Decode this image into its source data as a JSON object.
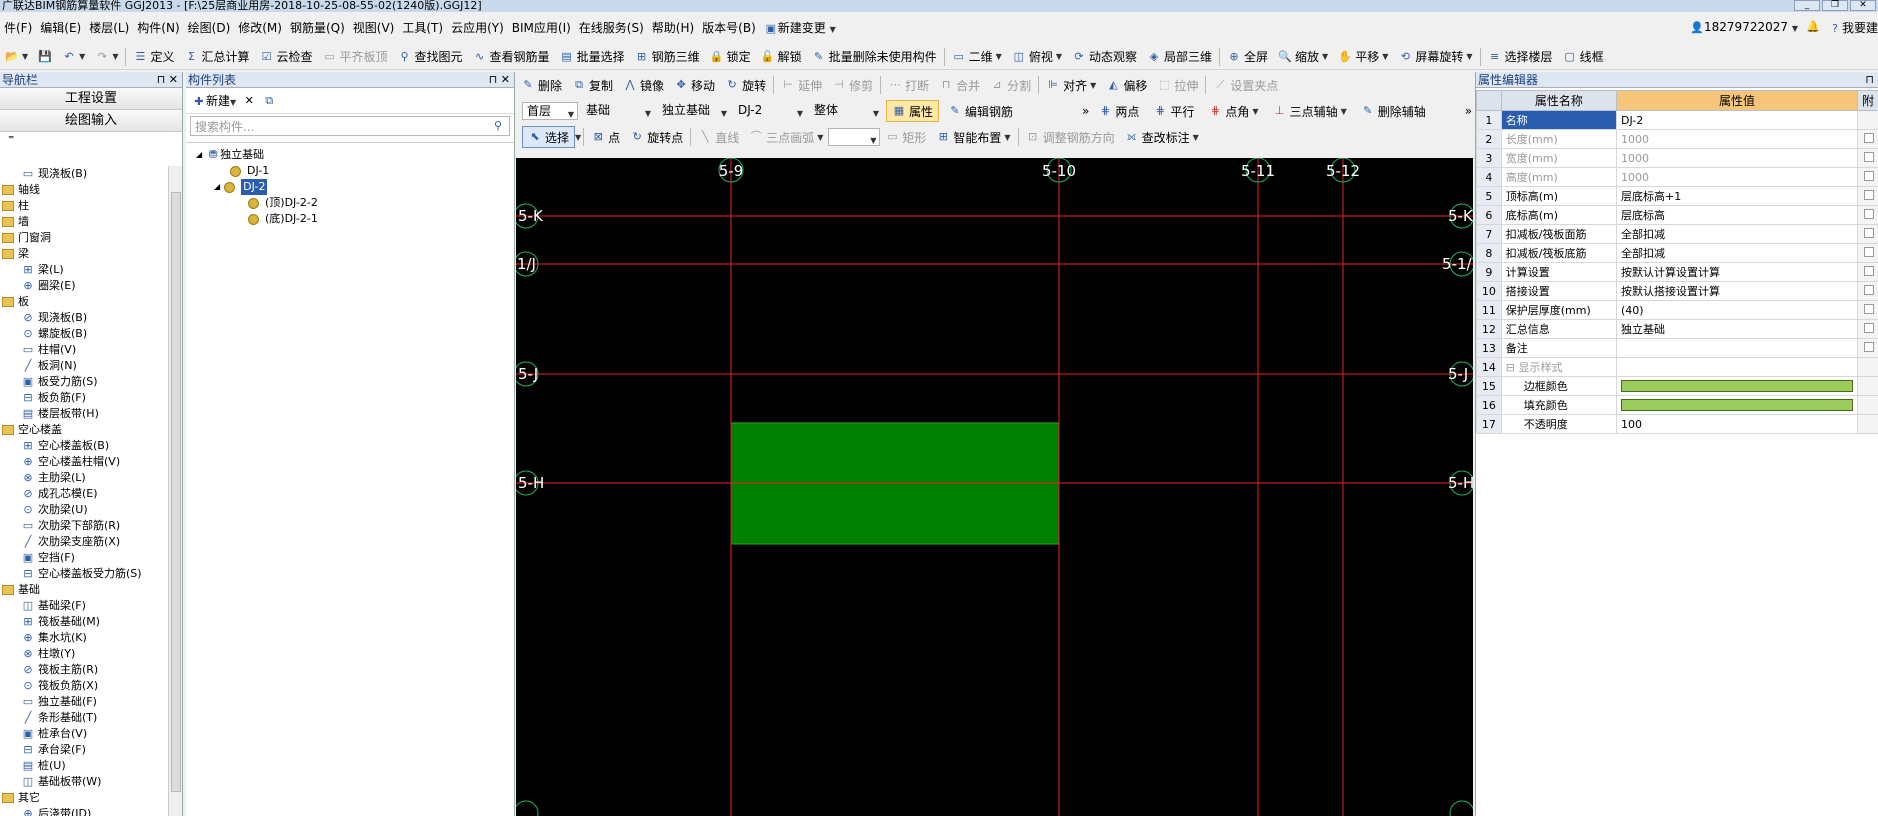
{
  "window": {
    "title": "广联达BIM钢筋算量软件 GGJ2013 - [F:\\25层商业用房-2018-10-25-08-55-02(1240版).GGJ12]"
  },
  "menu": {
    "items": [
      "件(F)",
      "编辑(E)",
      "楼层(L)",
      "构件(N)",
      "绘图(D)",
      "修改(M)",
      "钢筋量(Q)",
      "视图(V)",
      "工具(T)",
      "云应用(Y)",
      "BIM应用(I)",
      "在线服务(S)",
      "帮助(H)",
      "版本号(B)",
      "新建变更"
    ],
    "phone": "18279722027",
    "right_text": "我要建"
  },
  "toolbar": {
    "items": [
      "定义",
      "汇总计算",
      "云检查",
      "平齐板顶",
      "查找图元",
      "查看钢筋量",
      "批量选择",
      "钢筋三维",
      "锁定",
      "解锁",
      "批量删除未使用构件",
      "二维",
      "俯视",
      "动态观察",
      "局部三维",
      "全屏",
      "缩放",
      "平移",
      "屏幕旋转",
      "选择楼层",
      "线框"
    ]
  },
  "nav": {
    "title": "导航栏",
    "btn_project": "工程设置",
    "btn_drawing": "绘图输入",
    "tree": [
      {
        "label": "现浇板(B)",
        "folder": false
      },
      {
        "label": "轴线",
        "folder": true
      },
      {
        "label": "柱",
        "folder": true
      },
      {
        "label": "墙",
        "folder": true
      },
      {
        "label": "门窗洞",
        "folder": true
      },
      {
        "label": "梁",
        "folder": true
      },
      {
        "label": "梁(L)",
        "folder": false
      },
      {
        "label": "圈梁(E)",
        "folder": false
      },
      {
        "label": "板",
        "folder": true
      },
      {
        "label": "现浇板(B)",
        "folder": false
      },
      {
        "label": "螺旋板(B)",
        "folder": false
      },
      {
        "label": "柱帽(V)",
        "folder": false
      },
      {
        "label": "板洞(N)",
        "folder": false
      },
      {
        "label": "板受力筋(S)",
        "folder": false
      },
      {
        "label": "板负筋(F)",
        "folder": false
      },
      {
        "label": "楼层板带(H)",
        "folder": false
      },
      {
        "label": "空心楼盖",
        "folder": true
      },
      {
        "label": "空心楼盖板(B)",
        "folder": false
      },
      {
        "label": "空心楼盖柱帽(V)",
        "folder": false
      },
      {
        "label": "主肋梁(L)",
        "folder": false
      },
      {
        "label": "成孔芯模(E)",
        "folder": false
      },
      {
        "label": "次肋梁(U)",
        "folder": false
      },
      {
        "label": "次肋梁下部筋(R)",
        "folder": false
      },
      {
        "label": "次肋梁支座筋(X)",
        "folder": false
      },
      {
        "label": "空挡(F)",
        "folder": false
      },
      {
        "label": "空心楼盖板受力筋(S)",
        "folder": false
      },
      {
        "label": "基础",
        "folder": true
      },
      {
        "label": "基础梁(F)",
        "folder": false
      },
      {
        "label": "筏板基础(M)",
        "folder": false
      },
      {
        "label": "集水坑(K)",
        "folder": false
      },
      {
        "label": "柱墩(Y)",
        "folder": false
      },
      {
        "label": "筏板主筋(R)",
        "folder": false
      },
      {
        "label": "筏板负筋(X)",
        "folder": false
      },
      {
        "label": "独立基础(F)",
        "folder": false
      },
      {
        "label": "条形基础(T)",
        "folder": false
      },
      {
        "label": "桩承台(V)",
        "folder": false
      },
      {
        "label": "承台梁(F)",
        "folder": false
      },
      {
        "label": "桩(U)",
        "folder": false
      },
      {
        "label": "基础板带(W)",
        "folder": false
      },
      {
        "label": "其它",
        "folder": true
      },
      {
        "label": "后浇带(JD)",
        "folder": false
      }
    ]
  },
  "components": {
    "title": "构件列表",
    "new_label": "新建",
    "search_placeholder": "搜索构件...",
    "tree": {
      "root": "独立基础",
      "dj1": "DJ-1",
      "dj2": "DJ-2",
      "child_top": "(顶)DJ-2-2",
      "child_bottom": "(底)DJ-2-1"
    }
  },
  "edit_toolbar": {
    "items": [
      "删除",
      "复制",
      "镜像",
      "移动",
      "旋转",
      "延伸",
      "修剪",
      "打断",
      "合并",
      "分割",
      "对齐",
      "偏移",
      "拉伸",
      "设置夹点"
    ]
  },
  "selector_bar": {
    "floor": "首层",
    "category": "基础",
    "type": "独立基础",
    "component": "DJ-2",
    "unit": "整体",
    "btn_props": "属性",
    "btn_edit_rebar": "编辑钢筋",
    "items": [
      "两点",
      "平行",
      "点角",
      "三点辅轴",
      "删除辅轴"
    ]
  },
  "draw_bar": {
    "items": [
      "选择",
      "点",
      "旋转点",
      "直线",
      "三点画弧",
      "矩形",
      "智能布置",
      "调整钢筋方向",
      "查改标注"
    ]
  },
  "canvas": {
    "v_axes": [
      "5-9",
      "5-10",
      "5-11",
      "5-12"
    ],
    "h_axes": [
      "5-K",
      "5-1/J",
      "5-J",
      "5-H"
    ],
    "right_labels": [
      "5-K",
      "5-1/",
      "5-J",
      "5-H"
    ],
    "element_fill": "#007f00",
    "axis_color": "#e41f24"
  },
  "props": {
    "title": "属性编辑器",
    "col_name": "属性名称",
    "col_value": "属性值",
    "col_extra": "附",
    "rows": [
      {
        "no": "1",
        "name": "名称",
        "value": "DJ-2"
      },
      {
        "no": "2",
        "name": "长度(mm)",
        "value": "1000"
      },
      {
        "no": "3",
        "name": "宽度(mm)",
        "value": "1000"
      },
      {
        "no": "4",
        "name": "高度(mm)",
        "value": "1000"
      },
      {
        "no": "5",
        "name": "顶标高(m)",
        "value": "层底标高+1"
      },
      {
        "no": "6",
        "name": "底标高(m)",
        "value": "层底标高"
      },
      {
        "no": "7",
        "name": "扣减板/筏板面筋",
        "value": "全部扣减"
      },
      {
        "no": "8",
        "name": "扣减板/筏板底筋",
        "value": "全部扣减"
      },
      {
        "no": "9",
        "name": "计算设置",
        "value": "按默认计算设置计算"
      },
      {
        "no": "10",
        "name": "搭接设置",
        "value": "按默认搭接设置计算"
      },
      {
        "no": "11",
        "name": "保护层厚度(mm)",
        "value": "(40)"
      },
      {
        "no": "12",
        "name": "汇总信息",
        "value": "独立基础"
      },
      {
        "no": "13",
        "name": "备注",
        "value": ""
      },
      {
        "no": "14",
        "name": "显示样式",
        "value": ""
      },
      {
        "no": "15",
        "name": "边框颜色",
        "value": ""
      },
      {
        "no": "16",
        "name": "填充颜色",
        "value": ""
      },
      {
        "no": "17",
        "name": "不透明度",
        "value": "100"
      }
    ],
    "swatch_color": "#9ccc5c"
  }
}
